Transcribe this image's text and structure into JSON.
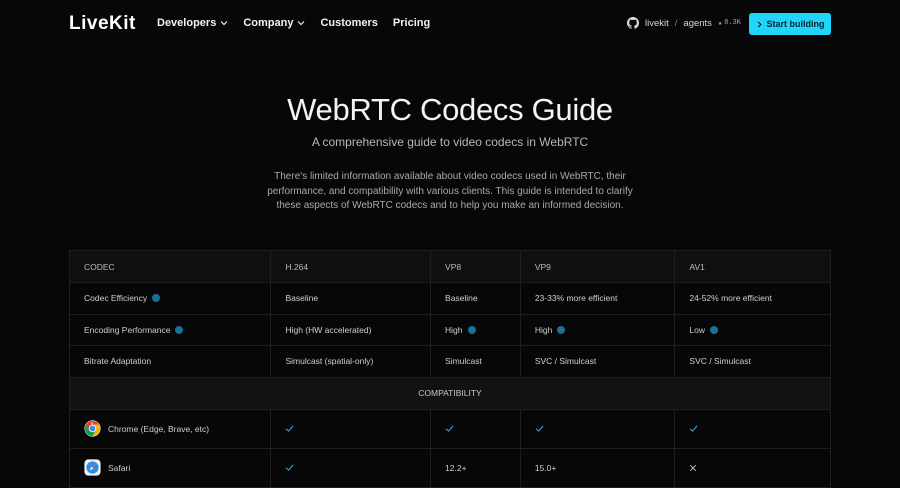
{
  "header": {
    "logo": "LiveKit",
    "nav": [
      {
        "label": "Developers",
        "dropdown": true
      },
      {
        "label": "Company",
        "dropdown": true
      },
      {
        "label": "Customers",
        "dropdown": false
      },
      {
        "label": "Pricing",
        "dropdown": false
      }
    ],
    "repo": {
      "owner": "livekit",
      "separator": "/",
      "name": "agents",
      "stars": "8.3K"
    },
    "cta_label": "Start building"
  },
  "hero": {
    "title": "WebRTC Codecs Guide",
    "subtitle": "A comprehensive guide to video codecs in WebRTC",
    "description": "There's limited information available about video codecs used in WebRTC, their performance, and compatibility with various clients. This guide is intended to clarify these aspects of WebRTC codecs and to help you make an informed decision."
  },
  "table": {
    "columns": [
      "CODEC",
      "H.264",
      "VP8",
      "VP9",
      "AV1"
    ],
    "rows": [
      {
        "label": "Codec Efficiency",
        "info": true,
        "cells": [
          {
            "text": "Baseline",
            "info": false
          },
          {
            "text": "Baseline",
            "info": false
          },
          {
            "text": "23-33% more efficient",
            "info": false
          },
          {
            "text": "24-52% more efficient",
            "info": false
          }
        ]
      },
      {
        "label": "Encoding Performance",
        "info": true,
        "cells": [
          {
            "text": "High (HW accelerated)",
            "info": false
          },
          {
            "text": "High",
            "info": true
          },
          {
            "text": "High",
            "info": true
          },
          {
            "text": "Low",
            "info": true
          }
        ]
      },
      {
        "label": "Bitrate Adaptation",
        "info": false,
        "cells": [
          {
            "text": "Simulcast (spatial-only)",
            "info": false
          },
          {
            "text": "Simulcast",
            "info": false
          },
          {
            "text": "SVC / Simulcast",
            "info": false
          },
          {
            "text": "SVC / Simulcast",
            "info": false
          }
        ]
      }
    ],
    "section_label": "COMPATIBILITY",
    "browsers": [
      {
        "name": "Chrome (Edge, Brave, etc)",
        "icon": "chrome-icon",
        "cells": [
          {
            "type": "check"
          },
          {
            "type": "check"
          },
          {
            "type": "check"
          },
          {
            "type": "check"
          }
        ]
      },
      {
        "name": "Safari",
        "icon": "safari-icon",
        "cells": [
          {
            "type": "check"
          },
          {
            "type": "text",
            "text": "12.2+"
          },
          {
            "type": "text",
            "text": "15.0+"
          },
          {
            "type": "cross"
          }
        ]
      }
    ]
  },
  "colors": {
    "background": "#070707",
    "accent": "#1fd5f9",
    "info_dot": "#1e6f96",
    "check": "#2fb8e6"
  }
}
